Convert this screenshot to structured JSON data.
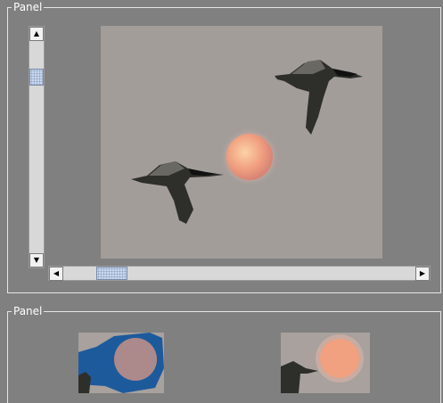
{
  "panels": {
    "top": {
      "title": "Panel"
    },
    "bottom": {
      "title": "Panel"
    }
  },
  "scrollbars": {
    "vertical": {
      "up_arrow": "▲",
      "down_arrow": "▼"
    },
    "horizontal": {
      "left_arrow": "◀",
      "right_arrow": "▶"
    }
  },
  "images": {
    "main": {
      "subject": "geese-flying-past-red-moon"
    },
    "thumbnail_left": {
      "subject": "moon-with-blue-selection-mask"
    },
    "thumbnail_right": {
      "subject": "moon-and-goose"
    }
  },
  "colors": {
    "background": "#808080",
    "border": "#e6e6e6",
    "sky": "#a39d9a",
    "moon": "#f0a080",
    "selection": "#1d5a9c"
  }
}
